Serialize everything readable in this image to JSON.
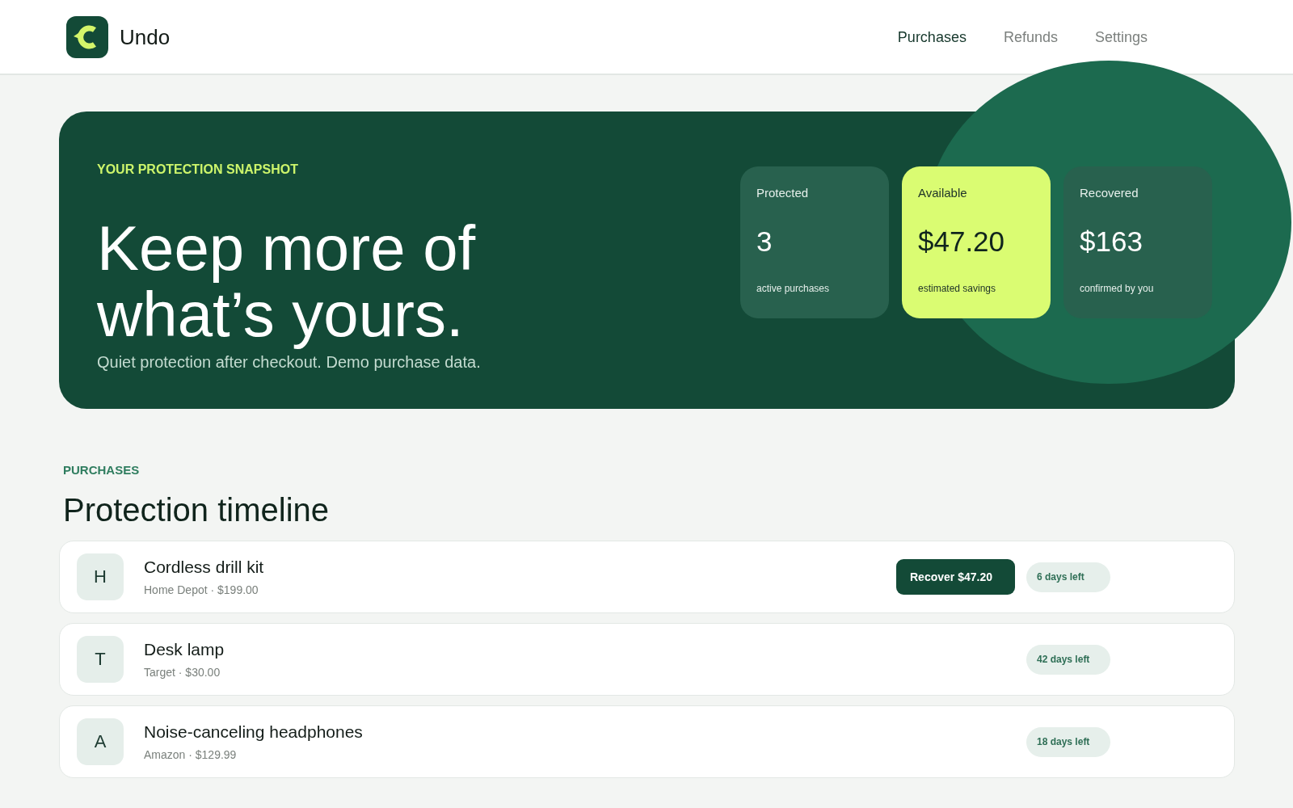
{
  "header": {
    "brand": "Undo",
    "nav": [
      {
        "label": "Purchases",
        "selected": true
      },
      {
        "label": "Refunds",
        "selected": false
      },
      {
        "label": "Settings",
        "selected": false
      }
    ]
  },
  "hero": {
    "eyebrow": "YOUR PROTECTION SNAPSHOT",
    "title": "Keep more of what’s yours.",
    "subtitle": "Quiet protection after checkout. Demo purchase data.",
    "stats": [
      {
        "kind": "default",
        "label": "Protected",
        "value": "3",
        "caption": "active purchases"
      },
      {
        "kind": "highlight",
        "label": "Available",
        "value": "$47.20",
        "caption": "estimated savings"
      },
      {
        "kind": "default",
        "label": "Recovered",
        "value": "$163",
        "caption": "confirmed by you"
      }
    ]
  },
  "purchases": {
    "eyebrow": "PURCHASES",
    "title": "Protection timeline",
    "items": [
      {
        "initial": "H",
        "name": "Cordless drill kit",
        "details": "Home Depot · $199.00",
        "action": "Recover $47.20",
        "days_left": "6 days left"
      },
      {
        "initial": "T",
        "name": "Desk lamp",
        "details": "Target · $30.00",
        "days_left": "42 days left"
      },
      {
        "initial": "A",
        "name": "Noise-canceling headphones",
        "details": "Amazon · $129.99",
        "days_left": "18 days left"
      }
    ]
  }
}
